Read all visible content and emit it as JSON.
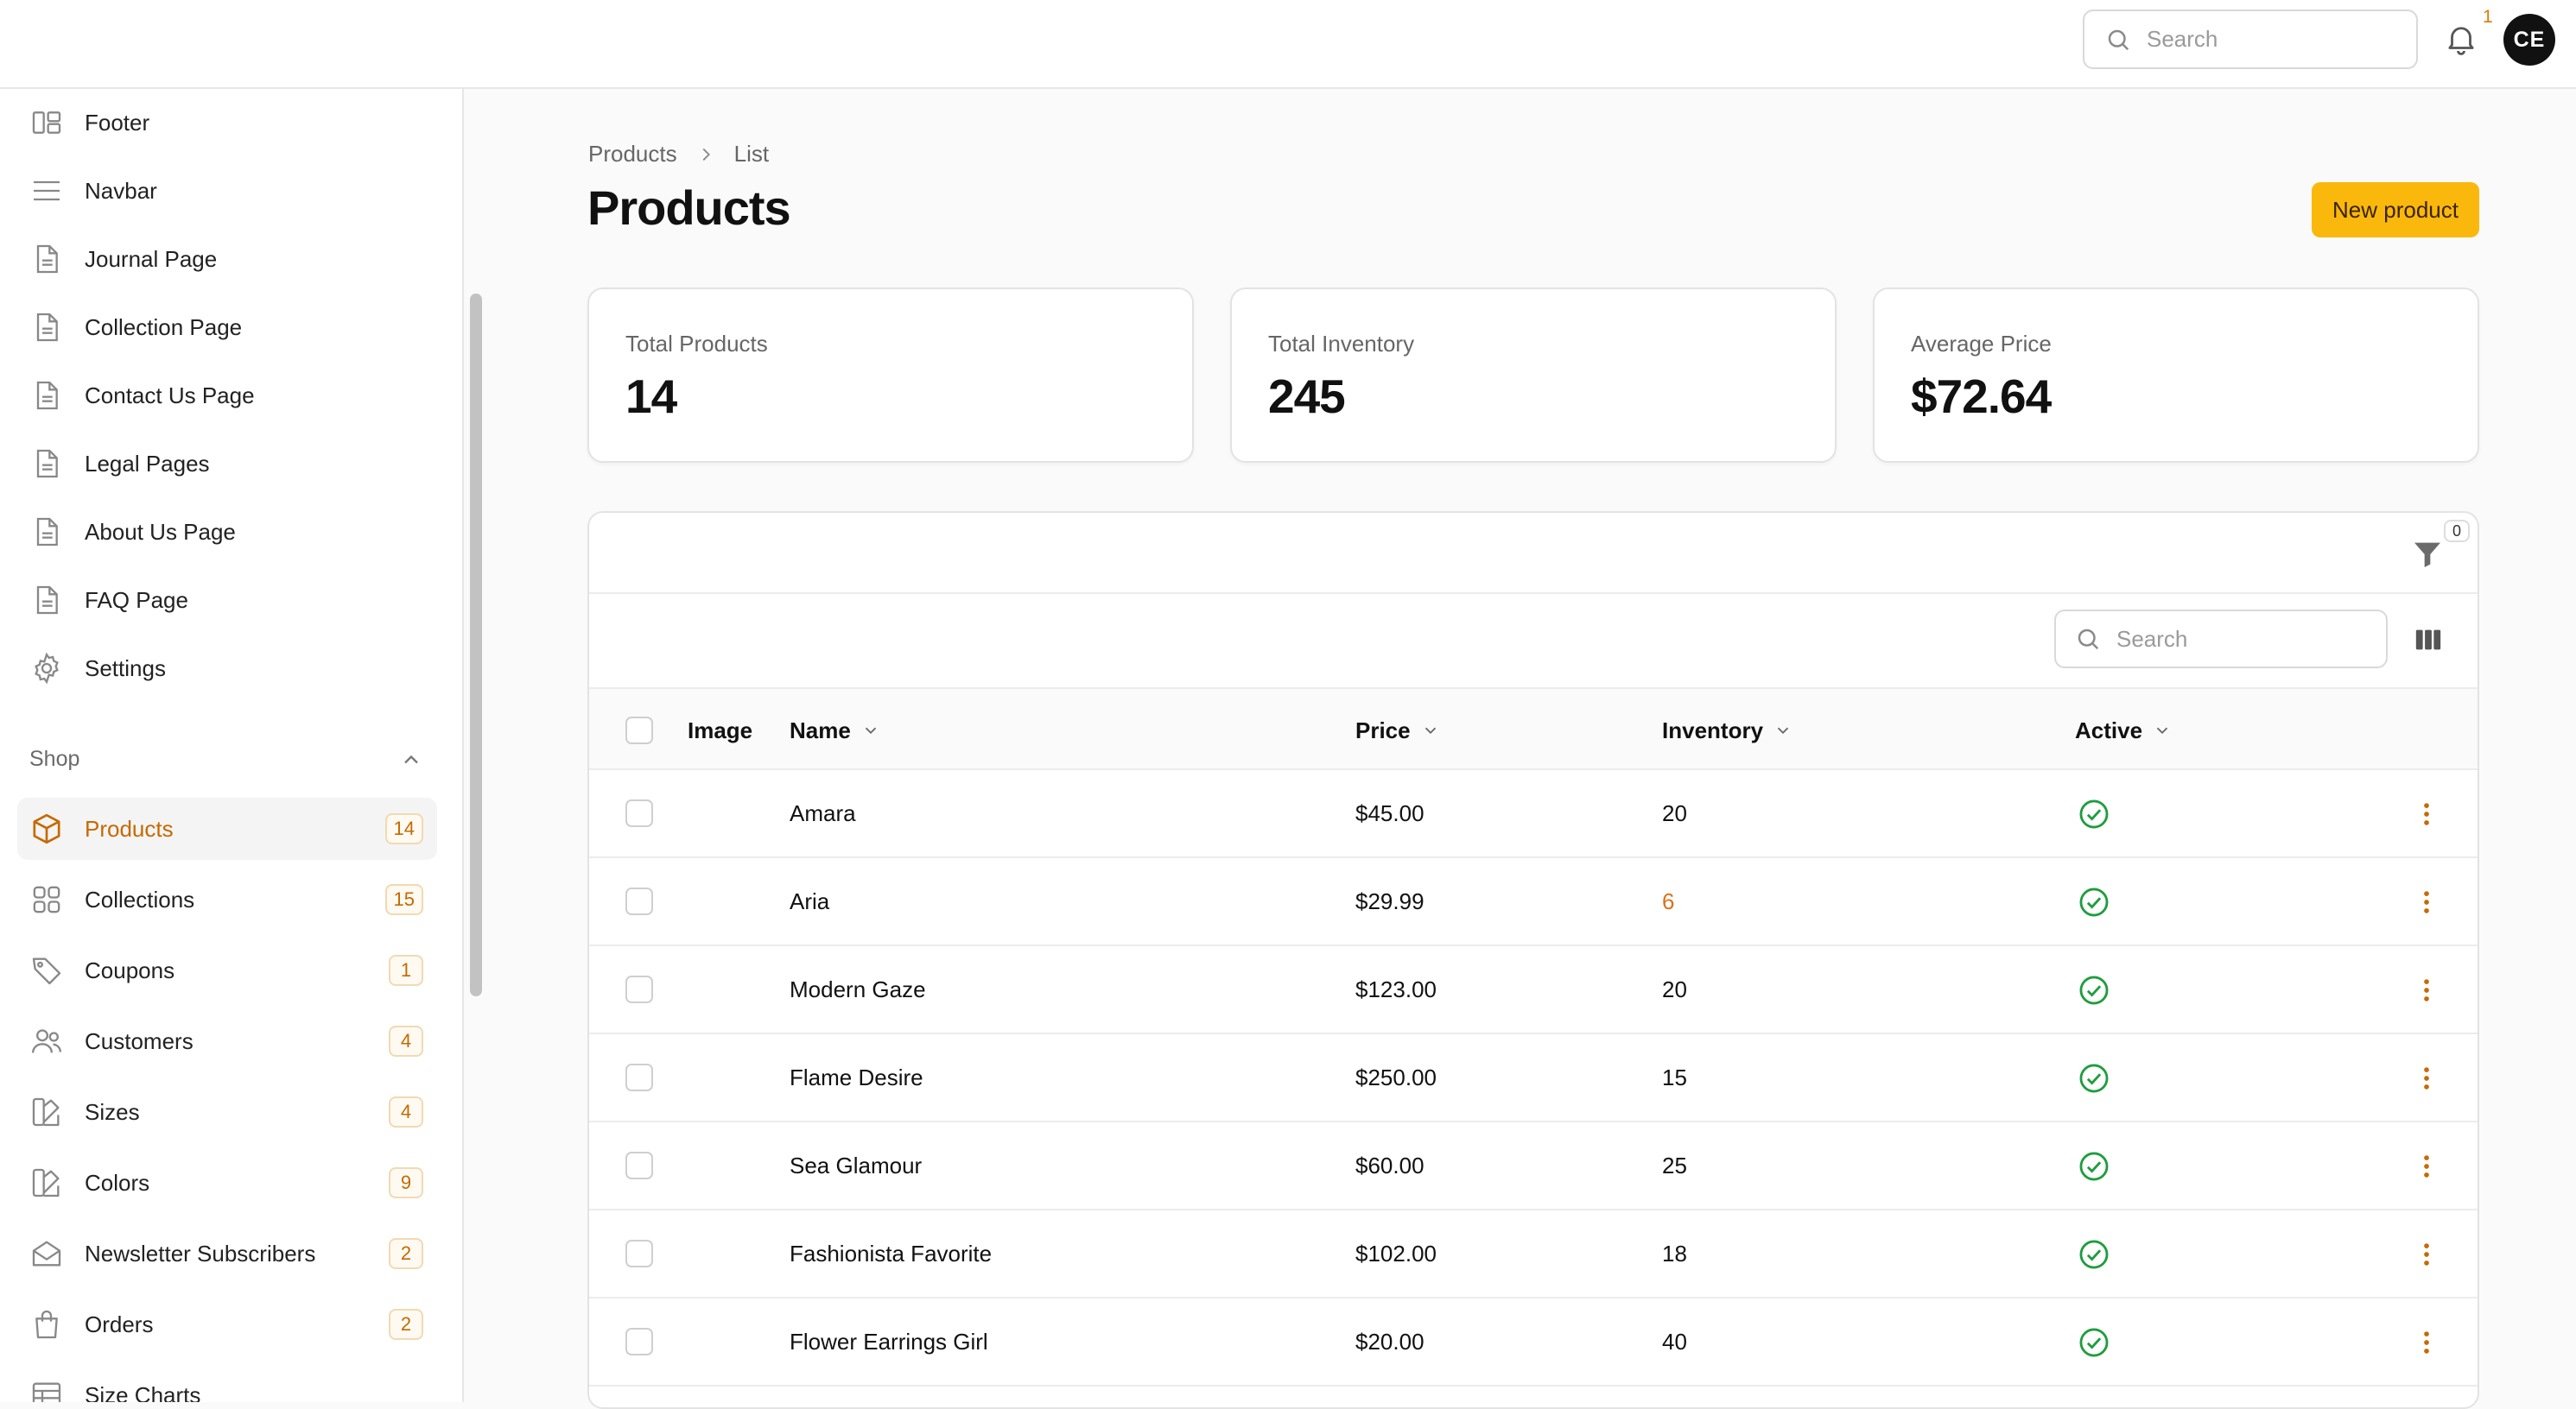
{
  "header": {
    "search_placeholder": "Search",
    "notification_count": "1",
    "avatar_initials": "CE"
  },
  "sidebar": {
    "items": [
      {
        "label": "Footer",
        "icon": "layout-icon"
      },
      {
        "label": "Navbar",
        "icon": "menu-icon"
      },
      {
        "label": "Journal Page",
        "icon": "document-icon"
      },
      {
        "label": "Collection Page",
        "icon": "document-icon"
      },
      {
        "label": "Contact Us Page",
        "icon": "document-icon"
      },
      {
        "label": "Legal Pages",
        "icon": "document-icon"
      },
      {
        "label": "About Us Page",
        "icon": "document-icon"
      },
      {
        "label": "FAQ Page",
        "icon": "document-icon"
      },
      {
        "label": "Settings",
        "icon": "gear-icon"
      }
    ],
    "shop_group": {
      "label": "Shop",
      "items": [
        {
          "label": "Products",
          "badge": "14",
          "icon": "cube-icon",
          "active": true
        },
        {
          "label": "Collections",
          "badge": "15",
          "icon": "grid-icon"
        },
        {
          "label": "Coupons",
          "badge": "1",
          "icon": "tag-icon"
        },
        {
          "label": "Customers",
          "badge": "4",
          "icon": "users-icon"
        },
        {
          "label": "Sizes",
          "badge": "4",
          "icon": "swatch-icon"
        },
        {
          "label": "Colors",
          "badge": "9",
          "icon": "swatch-icon"
        },
        {
          "label": "Newsletter Subscribers",
          "badge": "2",
          "icon": "envelope-icon"
        },
        {
          "label": "Orders",
          "badge": "2",
          "icon": "shopping-bag-icon"
        },
        {
          "label": "Size Charts",
          "icon": "table-icon"
        }
      ]
    }
  },
  "breadcrumb": [
    "Products",
    "List"
  ],
  "page_title": "Products",
  "new_button_label": "New product",
  "stats": [
    {
      "label": "Total Products",
      "value": "14"
    },
    {
      "label": "Total Inventory",
      "value": "245"
    },
    {
      "label": "Average Price",
      "value": "$72.64"
    }
  ],
  "table": {
    "filter_count": "0",
    "search_placeholder": "Search",
    "columns": {
      "image": "Image",
      "name": "Name",
      "price": "Price",
      "inventory": "Inventory",
      "active": "Active"
    },
    "rows": [
      {
        "name": "Amara",
        "price": "$45.00",
        "inventory": "20",
        "active": true
      },
      {
        "name": "Aria",
        "price": "$29.99",
        "inventory": "6",
        "active": true,
        "low_stock": true
      },
      {
        "name": "Modern Gaze",
        "price": "$123.00",
        "inventory": "20",
        "active": true
      },
      {
        "name": "Flame Desire",
        "price": "$250.00",
        "inventory": "15",
        "active": true
      },
      {
        "name": "Sea Glamour",
        "price": "$60.00",
        "inventory": "25",
        "active": true
      },
      {
        "name": "Fashionista Favorite",
        "price": "$102.00",
        "inventory": "18",
        "active": true
      },
      {
        "name": "Flower Earrings Girl",
        "price": "$20.00",
        "inventory": "40",
        "active": true
      }
    ]
  },
  "colors": {
    "accent": "#fbb80c",
    "active_nav": "#c56a00",
    "low_stock": "#d9731a",
    "success": "#1f9d3e"
  }
}
